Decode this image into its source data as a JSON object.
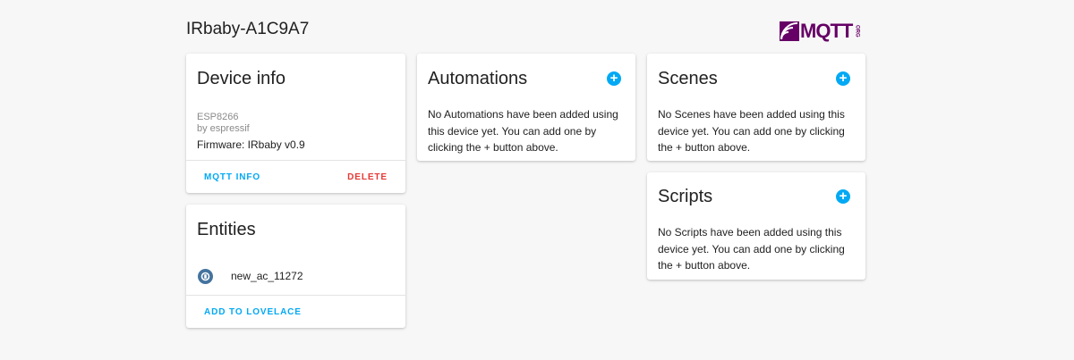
{
  "page": {
    "title": "IRbaby-A1C9A7"
  },
  "logo": {
    "text": "MQTT",
    "suffix": "ORG"
  },
  "device_info": {
    "title": "Device info",
    "model": "ESP8266",
    "manufacturer": "by espressif",
    "firmware": "Firmware: IRbaby v0.9",
    "mqtt_info_label": "MQTT INFO",
    "delete_label": "DELETE"
  },
  "entities": {
    "title": "Entities",
    "items": [
      {
        "name": "new_ac_11272",
        "icon": "air-conditioner-icon"
      }
    ],
    "add_to_lovelace_label": "ADD TO LOVELACE"
  },
  "automations": {
    "title": "Automations",
    "add_icon": "+",
    "empty_text": "No Automations have been added using this device yet. You can add one by clicking the + button above."
  },
  "scenes": {
    "title": "Scenes",
    "add_icon": "+",
    "empty_text": "No Scenes have been added using this device yet. You can add one by clicking the + button above."
  },
  "scripts": {
    "title": "Scripts",
    "add_icon": "+",
    "empty_text": "No Scripts have been added using this device yet. You can add one by clicking the + button above."
  },
  "colors": {
    "accent": "#03a9f4",
    "danger": "#e53935",
    "icon": "#44739e",
    "logo": "#660066"
  }
}
